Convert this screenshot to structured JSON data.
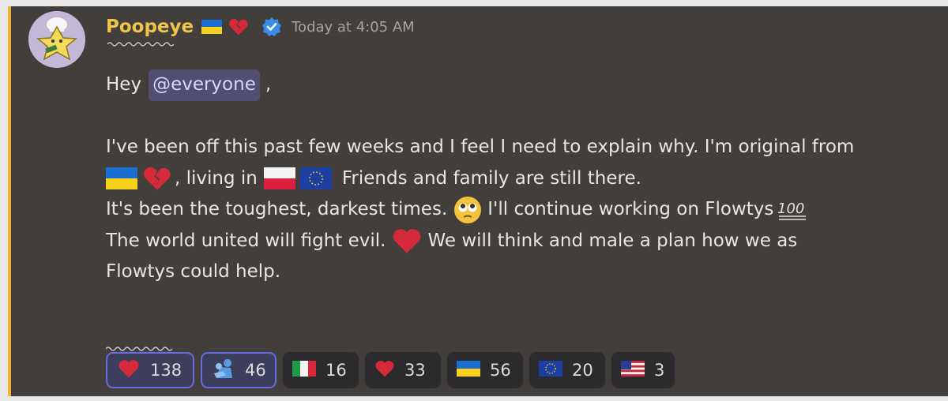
{
  "message": {
    "author": "Poopeye",
    "timestamp": "Today at 4:05 AM",
    "mention": "@everyone",
    "lines": {
      "l1_pre": "Hey",
      "l1_post": ",",
      "l2": "I've been off this past few weeks and I feel I need to explain why. I'm original from",
      "l3a": ", living in",
      "l3b": "Friends and family are still there.",
      "l4a": "It's been the toughest, darkest times.",
      "l4b": "I'll continue working on Flowtys",
      "l5a": "The world united will fight evil.",
      "l5b": "We will think and male a plan how we as",
      "l6": "Flowtys could help."
    }
  },
  "reactions": [
    {
      "icon": "heart-icon",
      "count": "138",
      "active": true
    },
    {
      "icon": "hug-icon",
      "count": "46",
      "active": true
    },
    {
      "icon": "italy-flag-icon",
      "count": "16",
      "active": false
    },
    {
      "icon": "heart-icon",
      "count": "33",
      "active": false
    },
    {
      "icon": "ukraine-flag-icon",
      "count": "56",
      "active": false
    },
    {
      "icon": "eu-flag-icon",
      "count": "20",
      "active": false
    },
    {
      "icon": "us-flag-icon",
      "count": "3",
      "active": false
    }
  ],
  "colors": {
    "background": "#413e3b",
    "accent_border": "#f0b232",
    "username": "#f0c44a",
    "mention_bg": "#524e70",
    "reaction_active_border": "#6a6bdc"
  }
}
